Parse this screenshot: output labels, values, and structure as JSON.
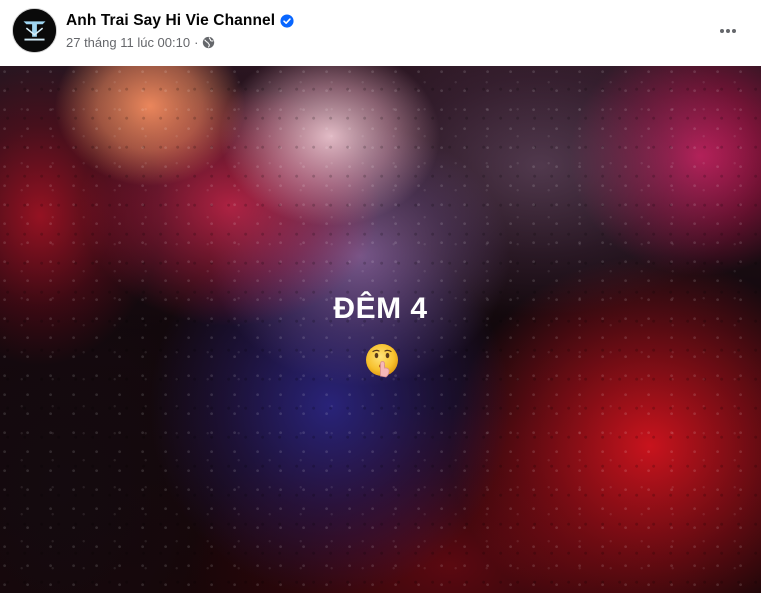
{
  "post": {
    "page_name": "Anh Trai Say Hi Vie Channel",
    "avatar_icon": "anh-trai-say-hi-logo-icon",
    "verified_icon": "verified-badge-icon",
    "timestamp": "27 tháng 11 lúc 00:10",
    "separator": "·",
    "audience_icon": "globe-icon",
    "more_icon": "more-options-icon",
    "media": {
      "caption": "ĐÊM 4",
      "emoji": "shushing-face-emoji"
    }
  },
  "colors": {
    "verified_blue": "#0866ff",
    "secondary_text": "#65676b",
    "primary_text": "#050505"
  }
}
